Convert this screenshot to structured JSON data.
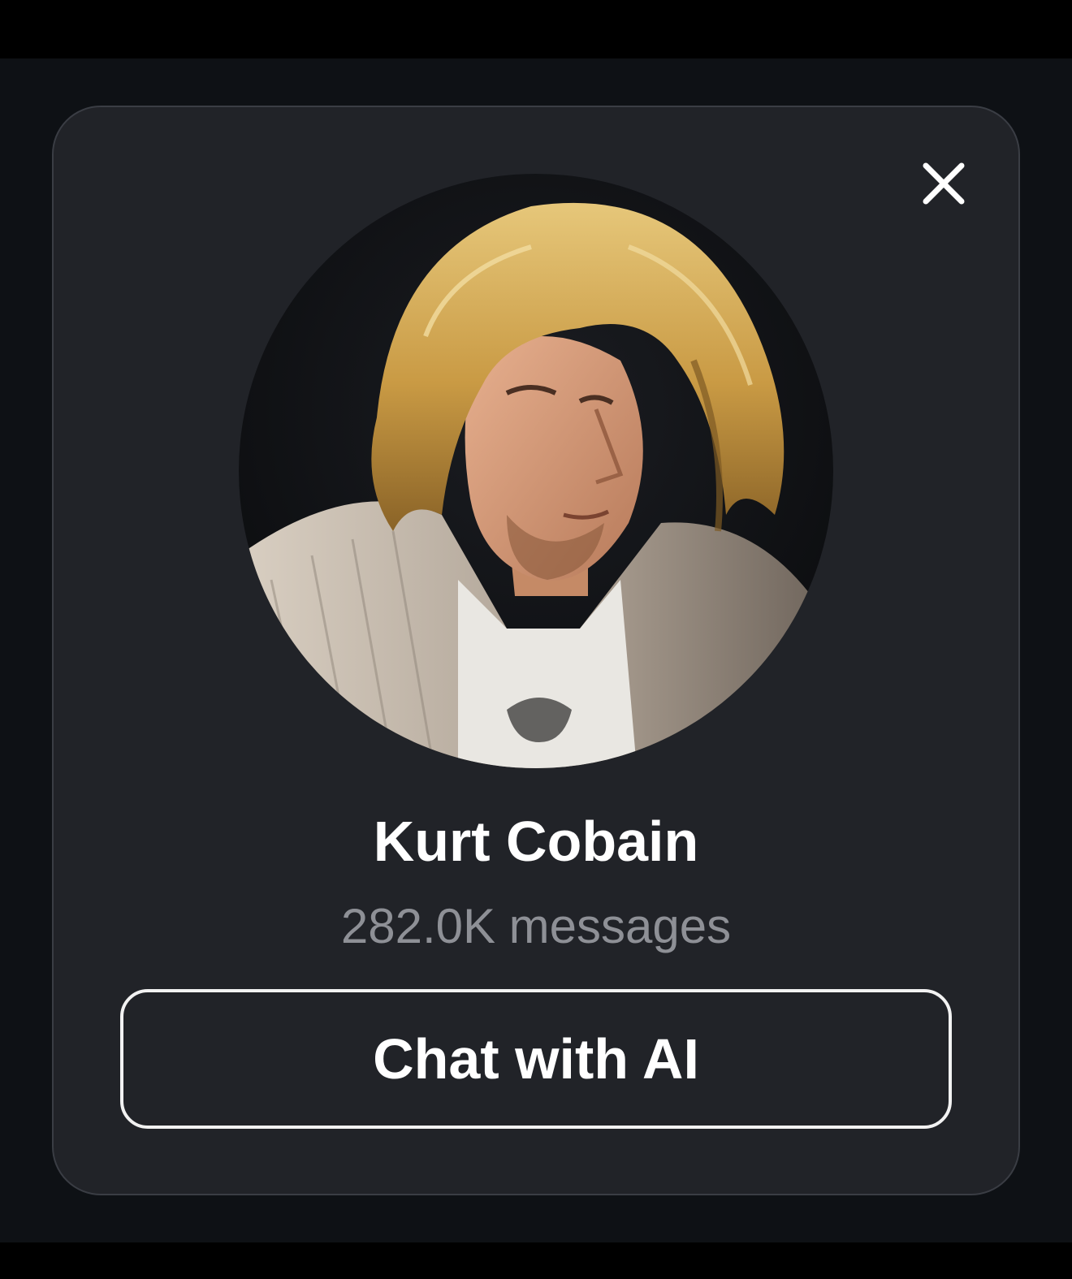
{
  "profile": {
    "name": "Kurt Cobain",
    "message_count": "282.0K messages",
    "avatar_alt": "Kurt Cobain"
  },
  "actions": {
    "chat_label": "Chat with AI"
  },
  "icons": {
    "close": "close-icon"
  },
  "colors": {
    "card_background": "#212328",
    "backdrop": "#0e1115",
    "text_primary": "#ffffff",
    "text_secondary": "#8e9096",
    "button_border": "#f2f2f2"
  }
}
